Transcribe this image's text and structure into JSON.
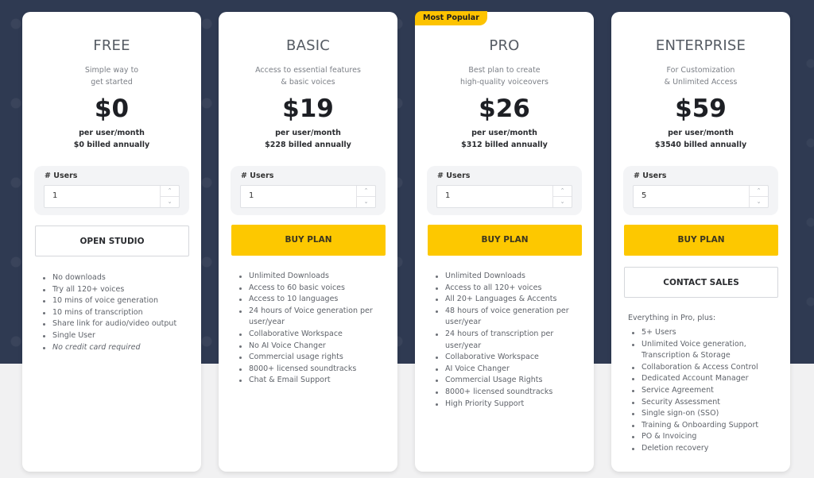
{
  "colors": {
    "accent": "#fdc800",
    "background_dark": "#2f3a52",
    "background_light": "#f1f1f2"
  },
  "plans": [
    {
      "name": "FREE",
      "description": [
        "Simple way to",
        "get started"
      ],
      "price": "$0",
      "per": "per user/month",
      "billed": "$0 billed annually",
      "users_label": "# Users",
      "users_value": "1",
      "primary_button": null,
      "secondary_button": "OPEN STUDIO",
      "features": [
        "No downloads",
        "Try all 120+ voices",
        "10 mins of voice generation",
        "10 mins of transcription",
        "Share link for audio/video output",
        "Single User",
        "No credit card required"
      ]
    },
    {
      "name": "BASIC",
      "description": [
        "Access to essential features",
        "& basic voices"
      ],
      "price": "$19",
      "per": "per user/month",
      "billed": "$228 billed annually",
      "users_label": "# Users",
      "users_value": "1",
      "primary_button": "BUY PLAN",
      "features": [
        "Unlimited Downloads",
        "Access to 60 basic voices",
        "Access to 10 languages",
        "24 hours of Voice generation per user/year",
        "Collaborative Workspace",
        "No AI Voice Changer",
        "Commercial usage rights",
        "8000+ licensed soundtracks",
        "Chat & Email Support"
      ]
    },
    {
      "name": "PRO",
      "badge": "Most Popular",
      "description": [
        "Best plan to create",
        "high-quality voiceovers"
      ],
      "price": "$26",
      "per": "per user/month",
      "billed": "$312 billed annually",
      "users_label": "# Users",
      "users_value": "1",
      "primary_button": "BUY PLAN",
      "features": [
        "Unlimited Downloads",
        "Access to all 120+ voices",
        "All 20+ Languages & Accents",
        "48 hours of voice generation per user/year",
        "24 hours of transcription per user/year",
        "Collaborative Workspace",
        "AI Voice Changer",
        "Commercial Usage Rights",
        "8000+ licensed soundtracks",
        "High Priority Support"
      ]
    },
    {
      "name": "ENTERPRISE",
      "description": [
        "For Customization",
        "& Unlimited Access"
      ],
      "price": "$59",
      "per": "per user/month",
      "billed": "$3540 billed annually",
      "users_label": "# Users",
      "users_value": "5",
      "primary_button": "BUY PLAN",
      "secondary_button": "CONTACT SALES",
      "features_intro": "Everything in Pro, plus:",
      "features": [
        "5+ Users",
        "Unlimited Voice generation, Transcription & Storage",
        "Collaboration & Access Control",
        "Dedicated Account Manager",
        "Service Agreement",
        "Security Assessment",
        "Single sign-on (SSO)",
        "Training & Onboarding Support",
        "PO & Invoicing",
        "Deletion recovery"
      ]
    }
  ],
  "icons": {
    "stepper_up": "chevron-up-icon",
    "stepper_down": "chevron-down-icon"
  }
}
